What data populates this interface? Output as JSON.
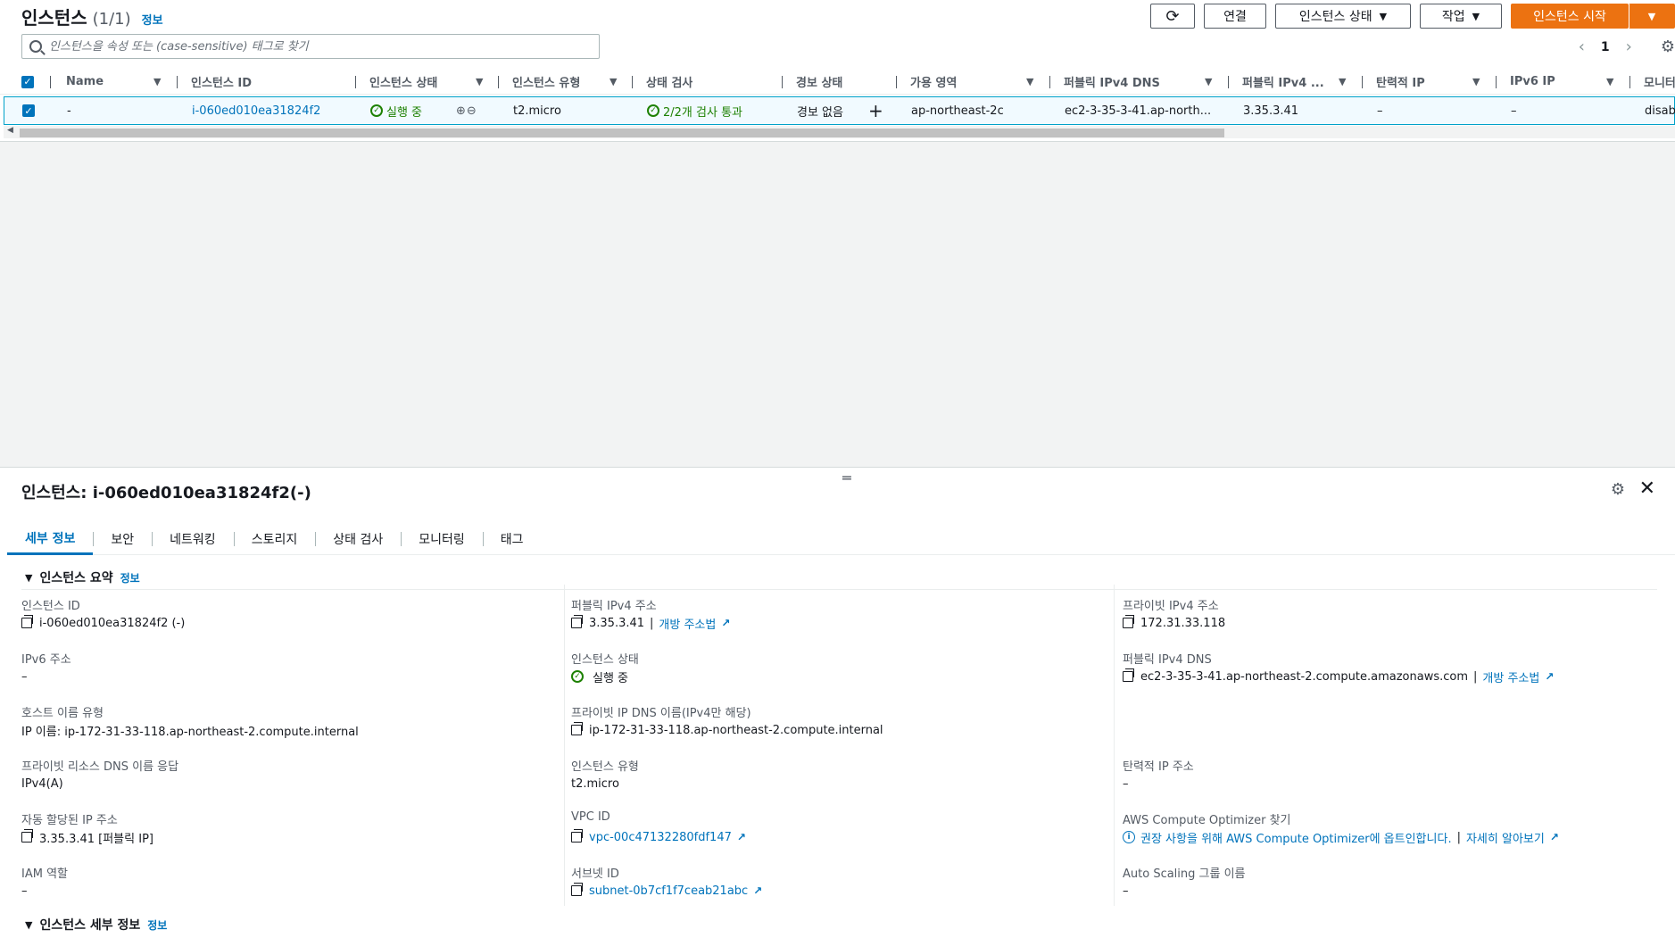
{
  "list": {
    "title": "인스턴스",
    "count": "(1/1)",
    "info": "정보",
    "search_placeholder": "인스턴스을 속성 또는 (case-sensitive) 태그로 찾기",
    "page": "1"
  },
  "actions": {
    "connect": "연결",
    "instance_state": "인스턴스 상태",
    "actions": "작업",
    "launch": "인스턴스 시작"
  },
  "columns": {
    "name": "Name",
    "instance_id": "인스턴스 ID",
    "instance_state": "인스턴스 상태",
    "instance_type": "인스턴스 유형",
    "status_check": "상태 검사",
    "alarm_status": "경보 상태",
    "availability_zone": "가용 영역",
    "public_dns": "퍼블릭 IPv4 DNS",
    "public_ip": "퍼블릭 IPv4 ...",
    "elastic_ip": "탄력적 IP",
    "ipv6": "IPv6 IP",
    "monitoring": "모니터"
  },
  "row": {
    "name": "-",
    "instance_id": "i-060ed010ea31824f2",
    "state": "실행 중",
    "type": "t2.micro",
    "status_check": "2/2개 검사 통과",
    "alarm": "경보 없음",
    "az": "ap-northeast-2c",
    "public_dns": "ec2-3-35-3-41.ap-north...",
    "public_ip": "3.35.3.41",
    "elastic_ip": "–",
    "ipv6": "–",
    "monitoring": "disabl"
  },
  "detail": {
    "title": "인스턴스: i-060ed010ea31824f2(-)",
    "tabs": [
      "세부 정보",
      "보안",
      "네트워킹",
      "스토리지",
      "상태 검사",
      "모니터링",
      "태그"
    ],
    "summary_title": "인스턴스 요약",
    "summary_info": "정보",
    "details_title": "인스턴스 세부 정보",
    "details_info": "정보",
    "col1": {
      "instance_id_label": "인스턴스 ID",
      "instance_id_value": "i-060ed010ea31824f2 (-)",
      "ipv6_label": "IPv6 주소",
      "ipv6_value": "–",
      "hostname_type_label": "호스트 이름 유형",
      "hostname_type_value": "IP 이름: ip-172-31-33-118.ap-northeast-2.compute.internal",
      "private_dns_answer_label": "프라이빗 리소스 DNS 이름 응답",
      "private_dns_answer_value": "IPv4(A)",
      "auto_ip_label": "자동 할당된 IP 주소",
      "auto_ip_value": "3.35.3.41 [퍼블릭 IP]",
      "iam_label": "IAM 역할",
      "iam_value": "–"
    },
    "col2": {
      "public_ip_label": "퍼블릭 IPv4 주소",
      "public_ip_value": "3.35.3.41",
      "open_address": "개방 주소법",
      "state_label": "인스턴스 상태",
      "state_value": "실행 중",
      "private_dns_label": "프라이빗 IP DNS 이름(IPv4만 해당)",
      "private_dns_value": "ip-172-31-33-118.ap-northeast-2.compute.internal",
      "type_label": "인스턴스 유형",
      "type_value": "t2.micro",
      "vpc_label": "VPC ID",
      "vpc_value": "vpc-00c47132280fdf147",
      "subnet_label": "서브넷 ID",
      "subnet_value": "subnet-0b7cf1f7ceab21abc"
    },
    "col3": {
      "private_ip_label": "프라이빗 IPv4 주소",
      "private_ip_value": "172.31.33.118",
      "public_dns_label": "퍼블릭 IPv4 DNS",
      "public_dns_value": "ec2-3-35-3-41.ap-northeast-2.compute.amazonaws.com",
      "open_address": "개방 주소법",
      "elastic_ip_label": "탄력적 IP 주소",
      "elastic_ip_value": "–",
      "optimizer_label": "AWS Compute Optimizer 찾기",
      "optimizer_value": "권장 사항을 위해 AWS Compute Optimizer에 옵트인합니다.",
      "learn_more": "자세히 알아보기",
      "asg_label": "Auto Scaling 그룹 이름",
      "asg_value": "–"
    }
  }
}
